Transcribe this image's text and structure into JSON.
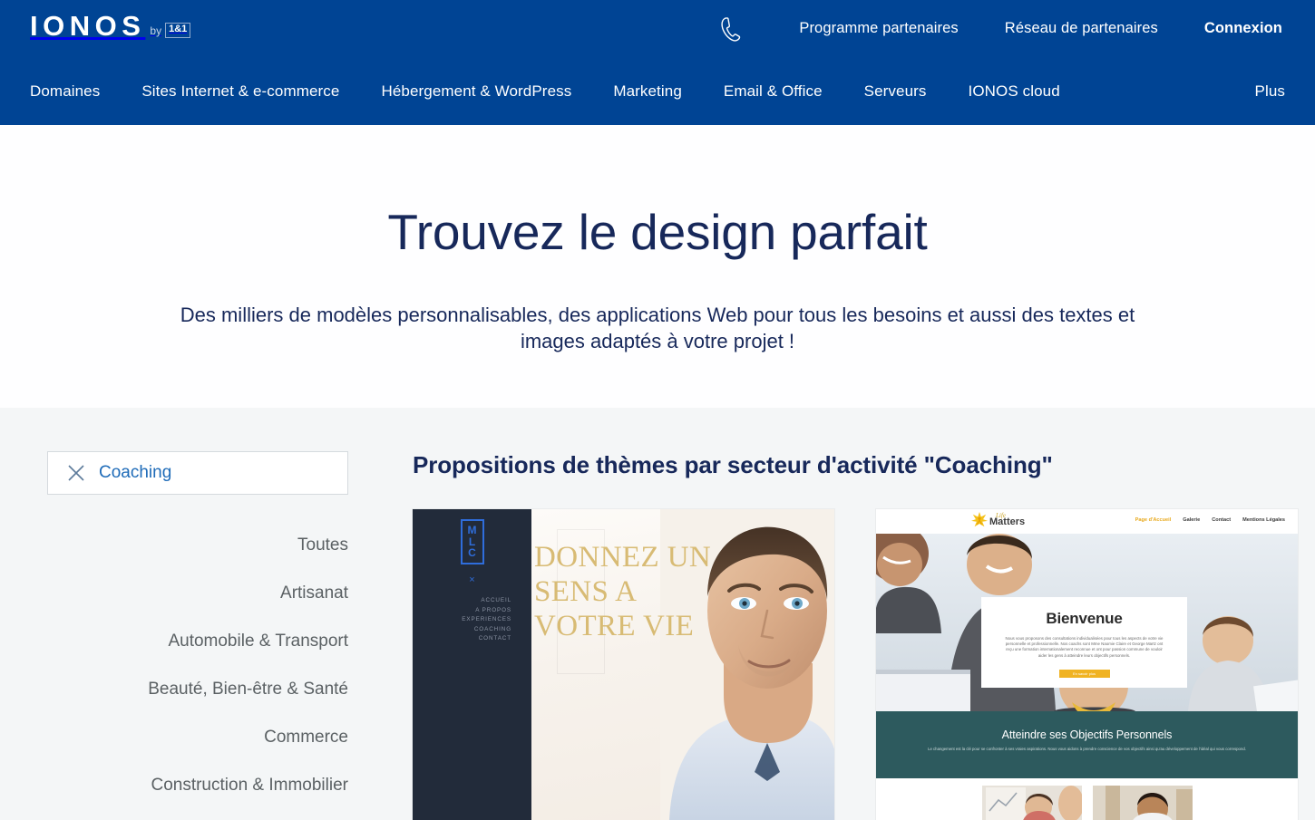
{
  "header": {
    "logo": {
      "word": "IONOS",
      "by": "by",
      "badge": "1&1"
    },
    "phone_icon": "phone-handset-icon",
    "top_links": [
      {
        "label": "Programme partenaires",
        "bold": false
      },
      {
        "label": "Réseau de partenaires",
        "bold": false
      },
      {
        "label": "Connexion",
        "bold": true
      }
    ],
    "nav_links": [
      "Domaines",
      "Sites Internet & e-commerce",
      "Hébergement & WordPress",
      "Marketing",
      "Email & Office",
      "Serveurs",
      "IONOS cloud"
    ],
    "nav_more": "Plus",
    "background": "#004494"
  },
  "hero": {
    "title": "Trouvez le design parfait",
    "subtitle": "Des milliers de modèles personnalisables, des applications Web pour tous les besoins et aussi des textes et images adaptés à votre projet !",
    "title_color": "#17285a",
    "background": "#fefeff"
  },
  "content": {
    "background": "#f4f6f7",
    "sidebar": {
      "filter_chip": {
        "label": "Coaching",
        "close_icon": "close-x-icon",
        "color": "#1E6BB8"
      },
      "categories": [
        "Toutes",
        "Artisanat",
        "Automobile & Transport",
        "Beauté, Bien-être & Santé",
        "Commerce",
        "Construction & Immobilier"
      ]
    },
    "panel": {
      "title": "Propositions de thèmes par secteur d'activité \"Coaching\"",
      "cards": [
        {
          "id": "mlc-template",
          "sidebar_logo": "MLC",
          "sidebar_mark": "×",
          "sidebar_nav": [
            "ACCUEIL",
            "A PROPOS",
            "EXPERIENCES",
            "COACHING",
            "CONTACT"
          ],
          "headline": "DONNEZ UN SENS A VOTRE VIE",
          "headline_color": "#d8bb74",
          "sidebar_bg": "#222b3a",
          "accent": "#2f6ddb"
        },
        {
          "id": "life-matters-template",
          "brand_script": "Life",
          "brand_bold": "Matters",
          "logo_icon": "sunburst-star-icon",
          "nav": [
            "Page d'Accueil",
            "Galerie",
            "Contact",
            "Mentions Légales"
          ],
          "welcome_title": "Bienvenue",
          "welcome_body": "Nous vous proposons des consultations individualisées pour tous les aspects de votre vie personnelle et professionnelle. Nos coachs sont Mme Naomie Claire et George Martz ont reçu une formation internationalement reconnue et ont pour passion commune de vouloir aider les gens à atteindre leurs objectifs personnels.",
          "cta_label": "En savoir plus",
          "cta_color": "#f0b323",
          "band_title": "Atteindre ses Objectifs Personnels",
          "band_body": "Le changement est la clé pour se confronter à ses vraies aspirations. Nous vous aidons à prendre conscience de vos objectifs ainsi qu'au développement de l'idéal qui vous correspond.",
          "band_bg": "#2d5a5e"
        }
      ]
    }
  }
}
